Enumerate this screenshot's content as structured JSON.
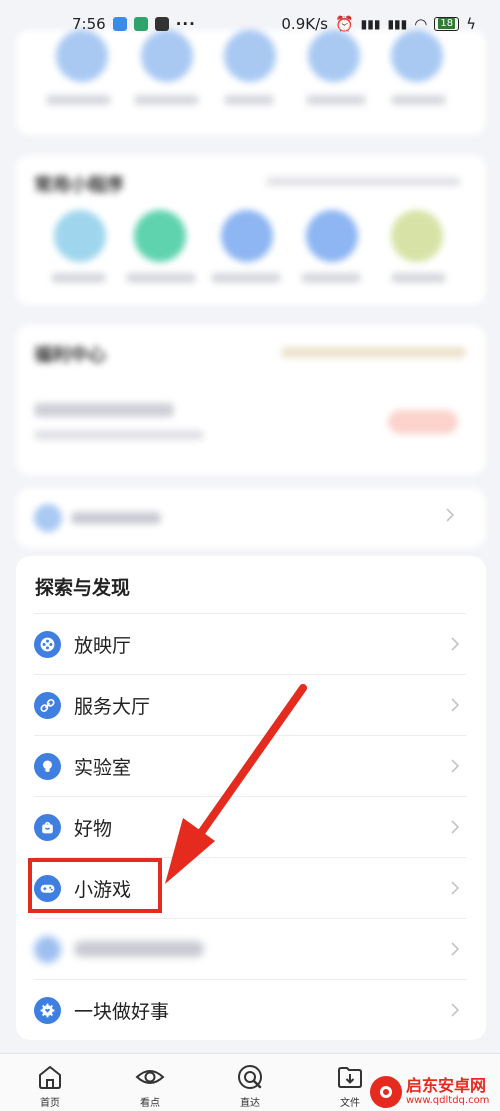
{
  "status_bar": {
    "time": "7:56",
    "dots": "···",
    "speed": "0.9K/s",
    "battery": "18"
  },
  "blurred": {
    "mini_programs_title": "常用小程序",
    "welfare_title": "福利中心"
  },
  "explore": {
    "title": "探索与发现",
    "items": [
      {
        "label": "放映厅",
        "icon": "film-reel-icon"
      },
      {
        "label": "服务大厅",
        "icon": "link-icon"
      },
      {
        "label": "实验室",
        "icon": "bulb-icon"
      },
      {
        "label": "好物",
        "icon": "shopping-bag-icon"
      },
      {
        "label": "小游戏",
        "icon": "gamepad-icon"
      },
      {
        "label": "",
        "icon": "blurred-icon"
      },
      {
        "label": "一块做好事",
        "icon": "gear-heart-icon"
      }
    ]
  },
  "bottom_nav": {
    "items": [
      {
        "label": "首页",
        "icon": "home-icon"
      },
      {
        "label": "看点",
        "icon": "eye-icon"
      },
      {
        "label": "直达",
        "icon": "search-target-icon"
      },
      {
        "label": "文件",
        "icon": "folder-download-icon"
      },
      {
        "label": "",
        "icon": "hidden"
      }
    ]
  },
  "watermark": {
    "name": "启东安卓网",
    "url": "www.qdltdq.com"
  },
  "colors": {
    "accent": "#3e7fe0",
    "annotation": "#e52a1e"
  }
}
